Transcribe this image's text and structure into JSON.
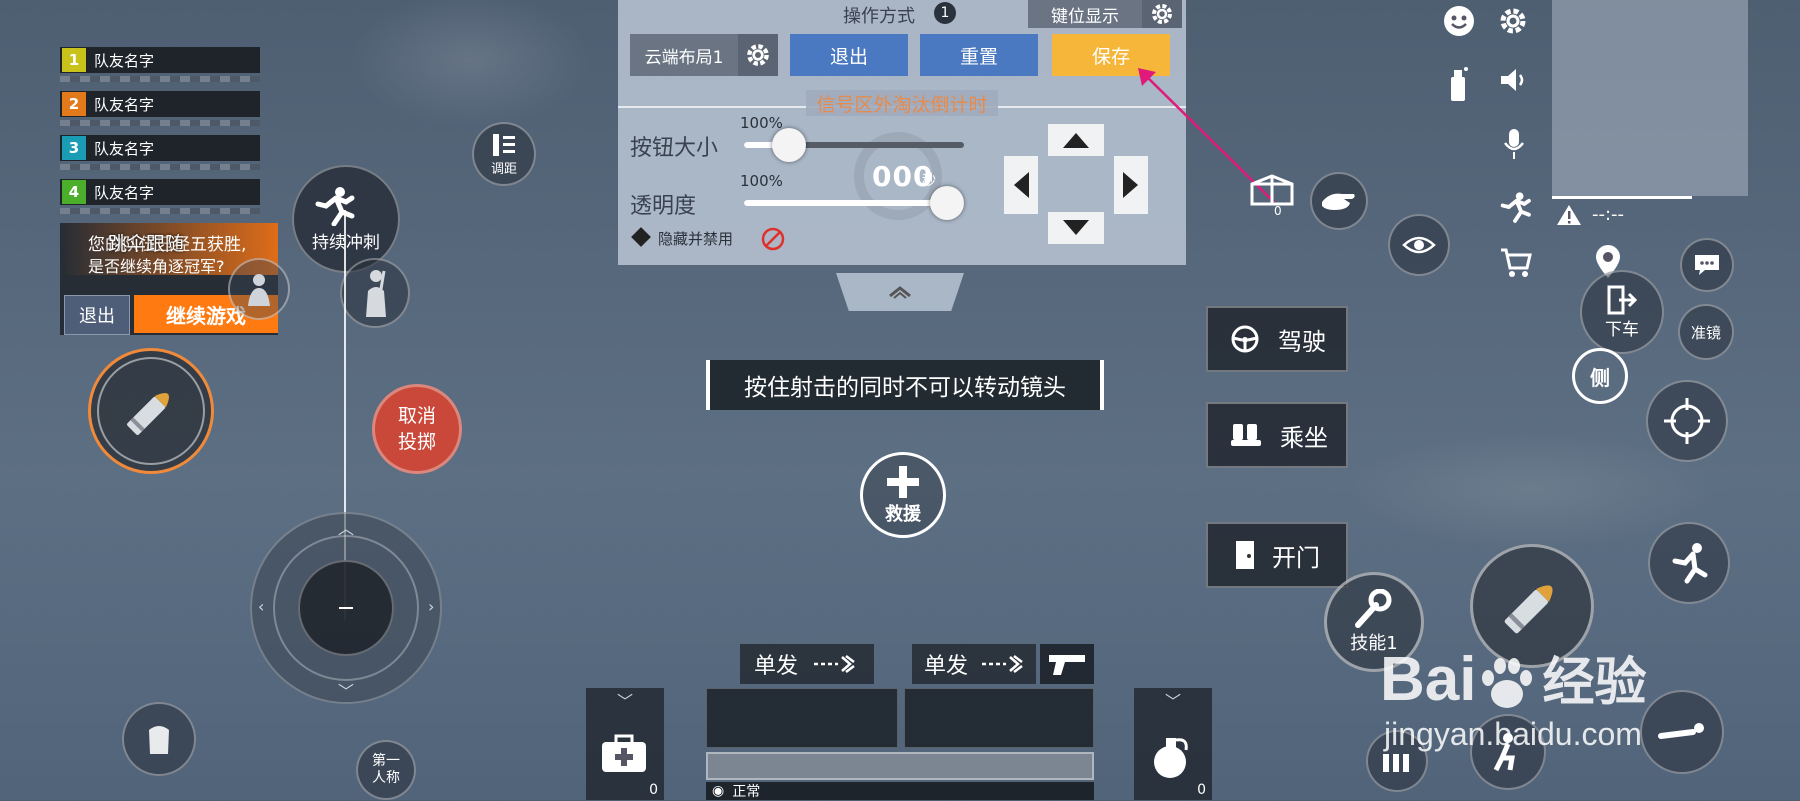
{
  "team": {
    "members": [
      {
        "num": "1",
        "name": "队友名字",
        "color": "#c9c21a"
      },
      {
        "num": "2",
        "name": "队友名字",
        "color": "#e2791a"
      },
      {
        "num": "3",
        "name": "队友名字",
        "color": "#1a9cb4"
      },
      {
        "num": "4",
        "name": "队友名字",
        "color": "#4caf2b"
      }
    ]
  },
  "follow": {
    "title": "跳伞跟随",
    "message_line1": "您的队伍已经五获胜,",
    "message_line2": "是否继续角逐冠军?",
    "exit_label": "退出",
    "continue_label": "继续游戏"
  },
  "left_controls": {
    "sprint_label": "持续冲刺",
    "range_label": "调距",
    "cancel_throw_label": "取消\n投掷",
    "perspective_label": "第一\n人称"
  },
  "panel": {
    "title": "操作方式",
    "title_badge": "1",
    "key_display_label": "键位显示",
    "layout_label": "云端布局1",
    "exit_label": "退出",
    "reset_label": "重置",
    "save_label": "保存",
    "countdown_text": "信号区外淘汰倒计时",
    "size_label": "按钮大小",
    "size_value": "100%",
    "size_level": 0.15,
    "opacity_label": "透明度",
    "opacity_value": "100%",
    "opacity_level": 1.0,
    "timer_digits": "000",
    "timer_unit": "秒",
    "hide_label": "隐藏并禁用"
  },
  "center": {
    "hint_text": "按住射击的同时不可以转动镜头",
    "rescue_label": "救援"
  },
  "actions": {
    "drive_label": "驾驶",
    "ride_label": "乘坐",
    "door_label": "开门"
  },
  "right_controls": {
    "exit_vehicle_label": "下车",
    "scope_label": "准镜",
    "side_label": "侧",
    "skill_label": "技能1",
    "supply_count": "0",
    "signal_text": "--:--"
  },
  "bottom": {
    "fire_mode_1": "单发",
    "fire_mode_2": "单发",
    "medkit_count": "0",
    "grenade_count": "0",
    "status_text": "正常"
  },
  "watermark": {
    "brand": "Bai",
    "brand2": "经验",
    "url": "jingyan.baidu.com"
  },
  "colors": {
    "save_button": "#f5b63a",
    "blue_button": "#4a79c2",
    "cancel_button": "#c9483a",
    "orange_accent": "#ff7a10",
    "annotation_arrow": "#e0197a",
    "countdown_text": "#e88a4a"
  }
}
